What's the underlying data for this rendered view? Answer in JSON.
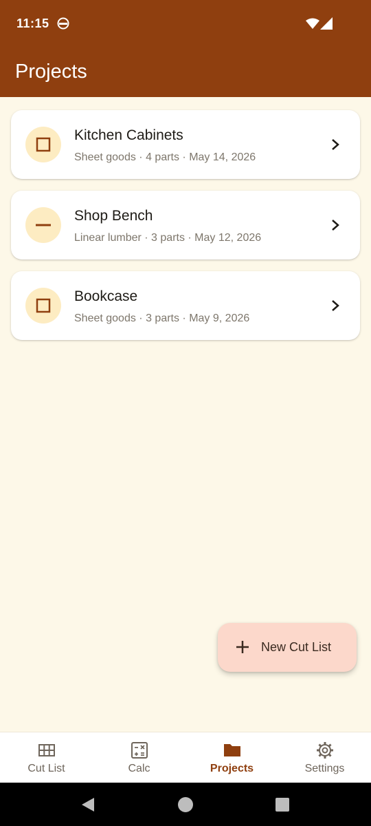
{
  "status_bar": {
    "time": "11:15"
  },
  "header": {
    "title": "Projects"
  },
  "projects": [
    {
      "name": "Kitchen Cabinets",
      "meta": "Sheet goods · 4 parts · May 14, 2026",
      "icon": "square-icon"
    },
    {
      "name": "Shop Bench",
      "meta": "Linear lumber · 3 parts · May 12, 2026",
      "icon": "minus-icon"
    },
    {
      "name": "Bookcase",
      "meta": "Sheet goods · 3 parts · May 9, 2026",
      "icon": "square-icon"
    }
  ],
  "fab": {
    "label": "New Cut List",
    "icon": "plus-icon"
  },
  "bottom_nav": {
    "items": [
      {
        "label": "Cut List",
        "icon": "grid-icon",
        "active": false
      },
      {
        "label": "Calc",
        "icon": "calculator-icon",
        "active": false
      },
      {
        "label": "Projects",
        "icon": "folder-icon",
        "active": true
      },
      {
        "label": "Settings",
        "icon": "gear-icon",
        "active": false
      }
    ]
  },
  "colors": {
    "appbar": "#8F3F0F",
    "background": "#FDF8E8",
    "badge": "#FDECC2",
    "fab": "#FCD8CB",
    "active_nav": "#8F3F0F"
  }
}
